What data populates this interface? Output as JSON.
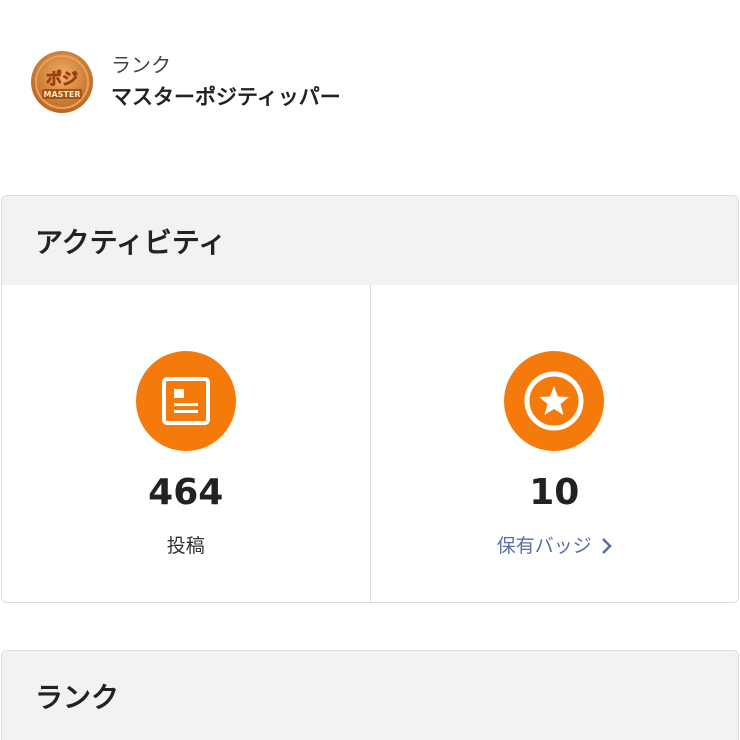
{
  "rank_header": {
    "label": "ランク",
    "name": "マスターポジティッパー",
    "badge_text": "ポジ",
    "badge_sub": "MASTER"
  },
  "activity": {
    "title": "アクティビティ",
    "posts": {
      "value": "464",
      "label": "投稿"
    },
    "badges": {
      "value": "10",
      "link_label": "保有バッジ"
    }
  },
  "rank_section": {
    "title": "ランク"
  },
  "colors": {
    "accent": "#f47a0c",
    "link": "#5a6fa8"
  }
}
